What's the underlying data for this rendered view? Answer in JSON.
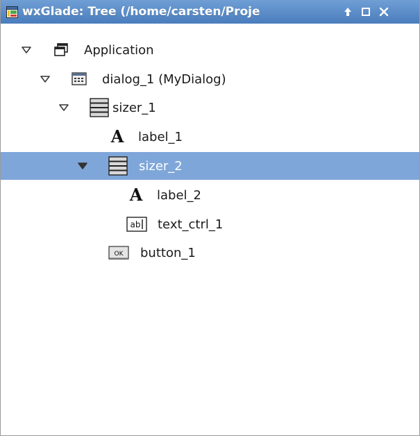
{
  "window": {
    "title": "wxGlade: Tree (/home/carsten/Projе",
    "icon": "wxglade-app-icon",
    "controls": [
      "keep-above-icon",
      "maximize-icon",
      "close-icon"
    ]
  },
  "tree": {
    "selection_color": "#7ea6d9",
    "items": [
      {
        "label": "Application",
        "icon": "application-window-icon",
        "expanded": true,
        "selected": false
      },
      {
        "label": "dialog_1 (MyDialog)",
        "icon": "dialog-icon",
        "expanded": true,
        "selected": false
      },
      {
        "label": "sizer_1",
        "icon": "vertical-sizer-icon",
        "expanded": true,
        "selected": false
      },
      {
        "label": "label_1",
        "icon": "static-text-icon",
        "expanded": null,
        "selected": false
      },
      {
        "label": "sizer_2",
        "icon": "vertical-sizer-icon",
        "expanded": true,
        "selected": true
      },
      {
        "label": "label_2",
        "icon": "static-text-icon",
        "expanded": null,
        "selected": false
      },
      {
        "label": "text_ctrl_1",
        "icon": "text-ctrl-icon",
        "expanded": null,
        "selected": false
      },
      {
        "label": "button_1",
        "icon": "button-icon",
        "expanded": null,
        "selected": false
      }
    ]
  }
}
